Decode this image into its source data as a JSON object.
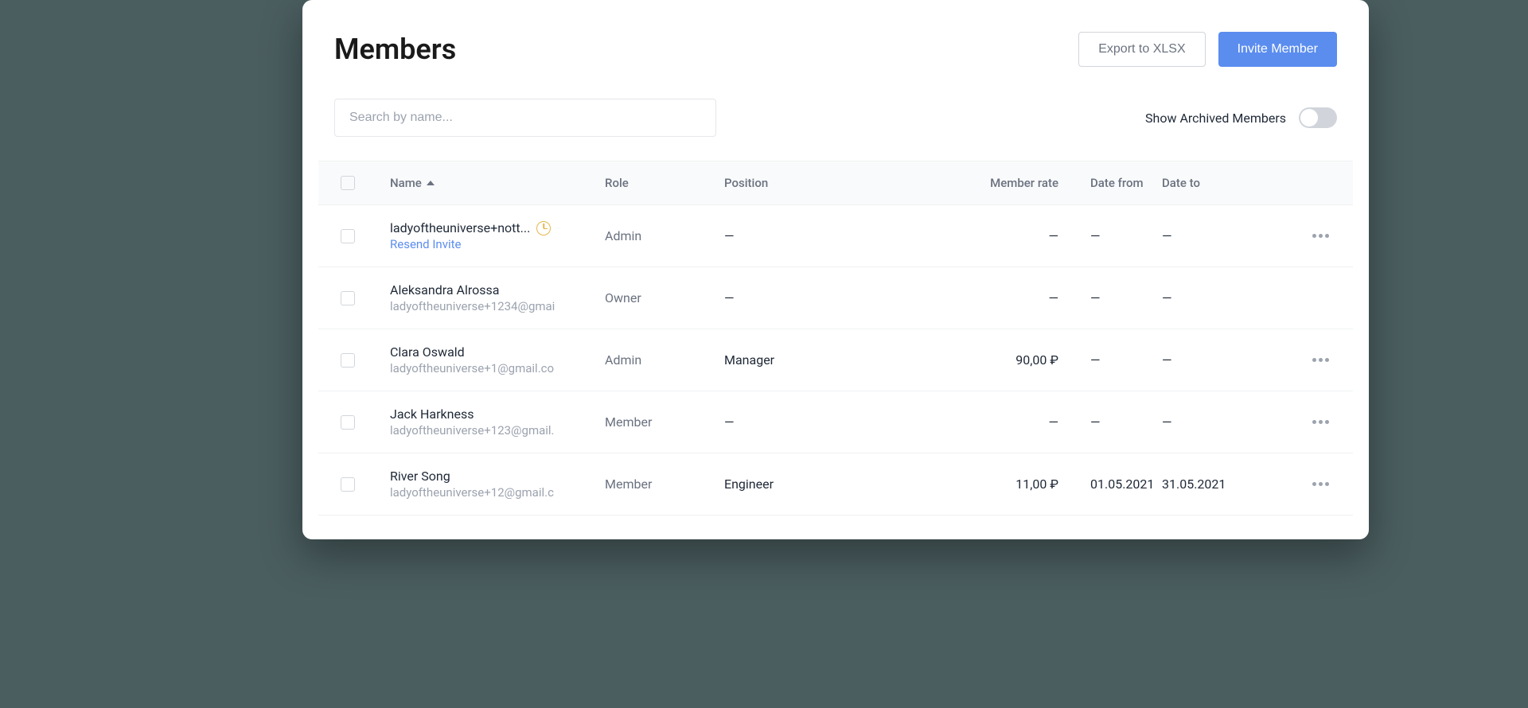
{
  "page": {
    "title": "Members"
  },
  "actions": {
    "export_label": "Export to XLSX",
    "invite_label": "Invite Member"
  },
  "search": {
    "placeholder": "Search by name..."
  },
  "toggle": {
    "label": "Show Archived Members"
  },
  "columns": {
    "name": "Name",
    "role": "Role",
    "position": "Position",
    "member_rate": "Member rate",
    "date_from": "Date from",
    "date_to": "Date to"
  },
  "rows": [
    {
      "name": "ladyoftheuniverse+nott...",
      "email": "",
      "resend": "Resend Invite",
      "pending": true,
      "role": "Admin",
      "position": "—",
      "rate": "—",
      "date_from": "—",
      "date_to": "—",
      "has_more": true
    },
    {
      "name": "Aleksandra Alrossa",
      "email": "ladyoftheuniverse+1234@gmai",
      "resend": "",
      "pending": false,
      "role": "Owner",
      "position": "—",
      "rate": "—",
      "date_from": "—",
      "date_to": "—",
      "has_more": false
    },
    {
      "name": "Clara Oswald",
      "email": "ladyoftheuniverse+1@gmail.co",
      "resend": "",
      "pending": false,
      "role": "Admin",
      "position": "Manager",
      "rate": "90,00 ₽",
      "date_from": "—",
      "date_to": "—",
      "has_more": true
    },
    {
      "name": "Jack Harkness",
      "email": "ladyoftheuniverse+123@gmail.",
      "resend": "",
      "pending": false,
      "role": "Member",
      "position": "—",
      "rate": "—",
      "date_from": "—",
      "date_to": "—",
      "has_more": true
    },
    {
      "name": "River Song",
      "email": "ladyoftheuniverse+12@gmail.c",
      "resend": "",
      "pending": false,
      "role": "Member",
      "position": "Engineer",
      "rate": "11,00 ₽",
      "date_from": "01.05.2021",
      "date_to": "31.05.2021",
      "has_more": true
    }
  ]
}
